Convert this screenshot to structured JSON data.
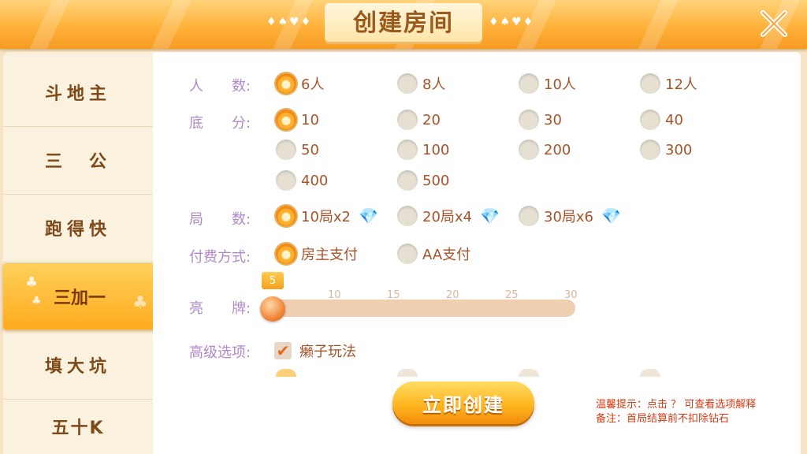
{
  "header": {
    "title": "创建房间",
    "left_suits": "♦♠♥♦",
    "right_suits": "♦♠♥♦"
  },
  "sidebar": {
    "items": [
      {
        "label": "斗地主"
      },
      {
        "label": "三　公"
      },
      {
        "label": "跑得快"
      },
      {
        "label": "三加一",
        "active": true
      },
      {
        "label": "填大坑"
      },
      {
        "label": "五十K"
      }
    ]
  },
  "form": {
    "players": {
      "label": "人　　数:",
      "options": [
        "6人",
        "8人",
        "10人",
        "12人"
      ],
      "selected": "6人"
    },
    "base_score": {
      "label": "底　　分:",
      "options": [
        "10",
        "20",
        "30",
        "40",
        "50",
        "100",
        "200",
        "300",
        "400",
        "500"
      ],
      "selected": "10"
    },
    "rounds": {
      "label": "局　　数:",
      "options": [
        "10局x2",
        "20局x4",
        "30局x6"
      ],
      "selected": "10局x2"
    },
    "payment": {
      "label": "付费方式:",
      "options": [
        "房主支付",
        "AA支付"
      ],
      "selected": "房主支付"
    },
    "bright": {
      "label": "亮　　牌:",
      "value": 5,
      "min": 5,
      "max": 30,
      "ticks": [
        "10",
        "15",
        "20",
        "25",
        "30"
      ]
    },
    "advanced": {
      "label": "高级选项:",
      "option": "癞子玩法",
      "checked": true
    }
  },
  "create_button": "立即创建",
  "notes": [
    "温馨提示：点击 ？ 可查看选项解释",
    "备注：首局结算前不扣除钻石"
  ],
  "colors": {
    "accent": "#ffb21c",
    "label": "#b189c8",
    "option_text": "#a5542a",
    "note": "#d63a14"
  }
}
